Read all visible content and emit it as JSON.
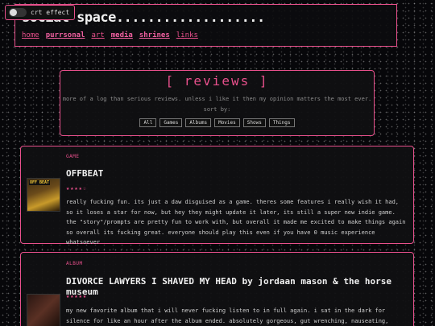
{
  "crt_toggle": {
    "label": "crt effect",
    "on": false
  },
  "site": {
    "title": "social space...................",
    "nav": [
      {
        "label": "home",
        "bold": false
      },
      {
        "label": "purrsonal",
        "bold": true
      },
      {
        "label": "art",
        "bold": false
      },
      {
        "label": "media",
        "bold": true
      },
      {
        "label": "shrines",
        "bold": true
      },
      {
        "label": "links",
        "bold": false
      }
    ]
  },
  "reviews_header": {
    "title": "[ reviews ]",
    "tagline": "more of a log than serious reviews. unless i like it then my opinion matters the most ever.",
    "sort_label": "sort by:",
    "filters": [
      "All",
      "Games",
      "Albums",
      "Movies",
      "Shows",
      "Things"
    ]
  },
  "reviews": [
    {
      "category": "GAME",
      "cover_label": "OFF BEAT",
      "title": "OFFBEAT",
      "rating": "★★★★☆",
      "body": "really fucking fun. its just a daw disguised as a game. theres some features i really wish it had, so it loses a star for now, but hey they might update it later, its still a super new indie game. the \"story\"/prompts are pretty fun to work with, but overall it made me excited to make things again so overall its fucking great. everyone should play this even if you have 0 music experience whatsoever"
    },
    {
      "category": "ALBUM",
      "cover_label": "",
      "title": "DIVORCE LAWYERS I SHAVED MY HEAD by jordaan mason & the horse museum",
      "rating": "★★★★★",
      "body": "my new favorite album that i will never fucking listen to in full again. i sat in the dark for silence for like an hour after the album ended. absolutely gorgeous, gut wrenching, nauseating, sometimes disgusting\" lyrics. jordaan's style of singing"
    }
  ],
  "colors": {
    "accent": "#e8508c",
    "background": "#07070a",
    "card": "#101012"
  }
}
